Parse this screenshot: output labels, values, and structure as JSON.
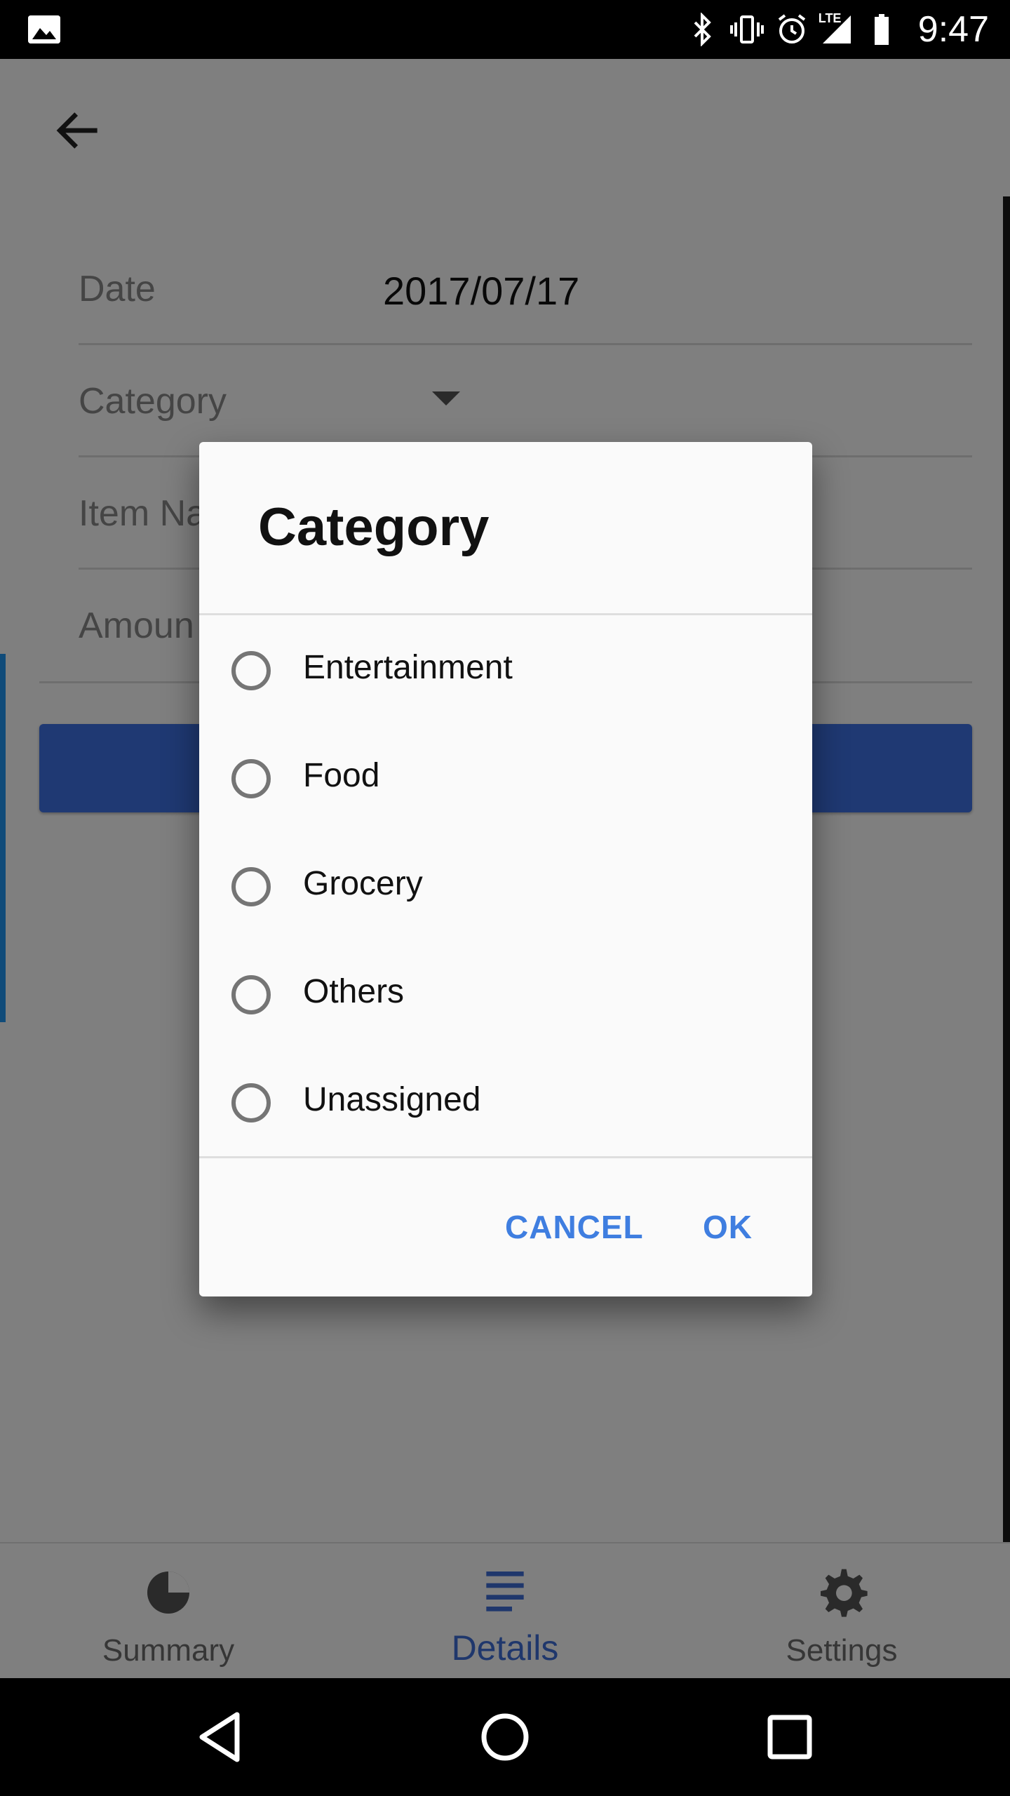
{
  "status_bar": {
    "time": "9:47",
    "icons": [
      "gallery-icon",
      "bluetooth-icon",
      "vibrate-icon",
      "alarm-icon",
      "lte-signal-icon",
      "battery-icon"
    ],
    "lte_text": "LTE"
  },
  "appbar": {
    "back_icon": "arrow-back-icon"
  },
  "form": {
    "date_label": "Date",
    "date_value": "2017/07/17",
    "category_label": "Category",
    "item_name_label": "Item Na",
    "amount_label": "Amoun"
  },
  "dialog": {
    "title": "Category",
    "options": [
      "Entertainment",
      "Food",
      "Grocery",
      "Others",
      "Unassigned"
    ],
    "cancel_label": "CANCEL",
    "ok_label": "OK"
  },
  "bottom_nav": {
    "items": [
      {
        "label": "Summary",
        "icon": "pie-chart-icon",
        "active": false
      },
      {
        "label": "Details",
        "icon": "list-lines-icon",
        "active": true
      },
      {
        "label": "Settings",
        "icon": "gear-icon",
        "active": false
      }
    ]
  },
  "colors": {
    "accent": "#3f7ee0",
    "primary_button": "#3f72e6",
    "scrim": "rgba(0,0,0,0.5)",
    "dialog_bg": "#fafafa"
  }
}
